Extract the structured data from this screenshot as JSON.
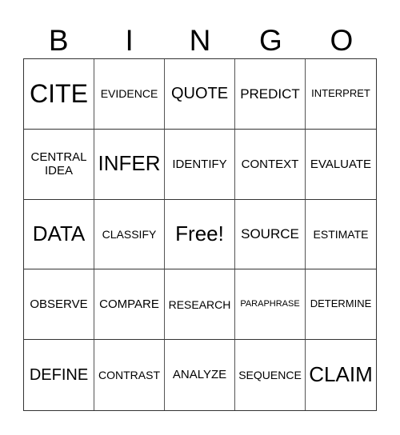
{
  "header": [
    "B",
    "I",
    "N",
    "G",
    "O"
  ],
  "cells": [
    "CITE",
    "EVIDENCE",
    "QUOTE",
    "PREDICT",
    "INTERPRET",
    "CENTRAL IDEA",
    "INFER",
    "IDENTIFY",
    "CONTEXT",
    "EVALUATE",
    "DATA",
    "CLASSIFY",
    "Free!",
    "SOURCE",
    "ESTIMATE",
    "OBSERVE",
    "COMPARE",
    "RESEARCH",
    "PARAPHRASE",
    "DETERMINE",
    "DEFINE",
    "CONTRAST",
    "ANALYZE",
    "SEQUENCE",
    "CLAIM"
  ]
}
